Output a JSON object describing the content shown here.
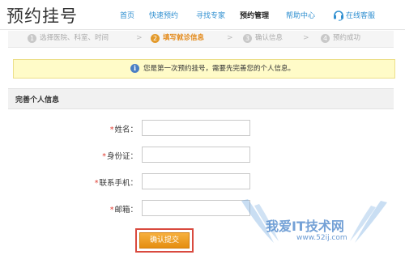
{
  "header": {
    "title": "预约挂号",
    "nav": [
      {
        "label": "首页",
        "active": false
      },
      {
        "label": "快速预约",
        "active": false
      },
      {
        "label": "寻找专家",
        "active": false
      },
      {
        "label": "预约管理",
        "active": true
      }
    ],
    "help_label": "帮助中心",
    "customer_service": {
      "label": "在线客服",
      "icon": "headset-icon"
    }
  },
  "steps": [
    {
      "num": "1",
      "label": "选择医院、科室、时间",
      "active": false
    },
    {
      "num": "2",
      "label": "填写就诊信息",
      "active": true
    },
    {
      "num": "3",
      "label": "确认信息",
      "active": false
    },
    {
      "num": "4",
      "label": "预约成功",
      "active": false
    }
  ],
  "step_arrow": ">",
  "notice": {
    "icon": "info-icon",
    "icon_glyph": "i",
    "text": "您是第一次预约挂号，需要先完善您的个人信息。"
  },
  "section": {
    "title": "完善个人信息"
  },
  "form": {
    "required_mark": "*",
    "fields": [
      {
        "label": "姓名：",
        "value": ""
      },
      {
        "label": "身份证：",
        "value": ""
      },
      {
        "label": "联系手机：",
        "value": ""
      },
      {
        "label": "邮箱：",
        "value": ""
      }
    ],
    "submit_label": "确认提交"
  },
  "watermark": {
    "text": "我爱IT技术网",
    "url": "www.52ij.com"
  },
  "colors": {
    "link": "#2f8fd0",
    "active_step": "#e38a1a",
    "notice_bg": "#fffbc8",
    "submit_bg": "#e58e10",
    "highlight_border": "#d94a3f",
    "required": "#e03c31"
  }
}
